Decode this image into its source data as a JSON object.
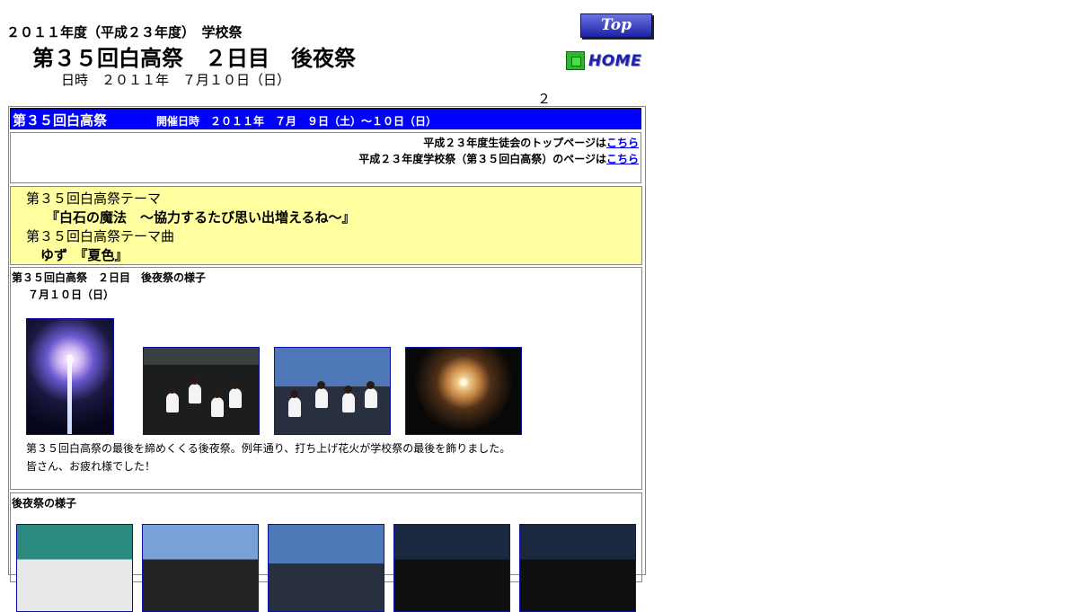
{
  "header": {
    "year_line": "２０１１年度（平成２３年度）　学校祭",
    "title": "第３５回白高祭　２日目　後夜祭",
    "date_line": "日時　２０１１年　７月１０日（日）",
    "page_number": "２"
  },
  "nav": {
    "top_label": "Top",
    "home_label": "HOME"
  },
  "festival_bar": {
    "name": "第３５回白高祭",
    "dates": "開催日時　２０１１年　７月　９日（土）～１０日（日）"
  },
  "links": [
    {
      "prefix": "平成２３年度生徒会のトップページは",
      "link": "こちら"
    },
    {
      "prefix": "平成２３年度学校祭（第３５回白高祭）のページは",
      "link": "こちら"
    }
  ],
  "theme": {
    "theme_label": "第３５回白高祭テーマ",
    "theme_value": "『白石の魔法　～協力するたび思い出増えるね～』",
    "song_label": "第３５回白高祭テーマ曲",
    "song_value": "ゆず　『夏色』"
  },
  "event": {
    "heading": "第３５回白高祭　２日目　後夜祭の様子",
    "date": "７月１０日（日）",
    "caption_1": "第３５回白高祭の最後を締めくくる後夜祭。例年通り、打ち上げ花火が学校祭の最後を飾りました。",
    "caption_2": "皆さん、お疲れ様でした！"
  },
  "after": {
    "heading": "後夜祭の様子"
  }
}
